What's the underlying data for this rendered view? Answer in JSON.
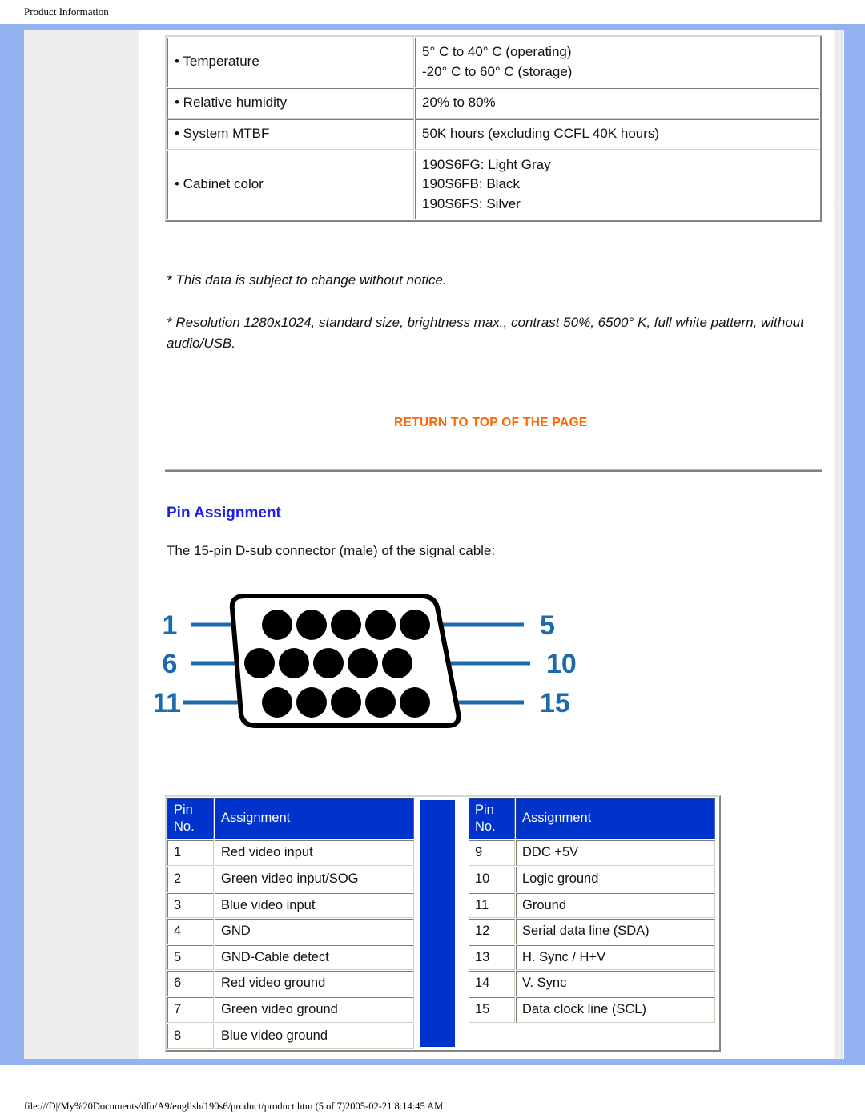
{
  "page": {
    "header_title": "Product Information",
    "footer": "file:///D|/My%20Documents/dfu/A9/english/190s6/product/product.htm (5 of 7)2005-02-21 8:14:45 AM"
  },
  "colors": {
    "frame_blue": "#93b2f2",
    "table_header_blue": "#0033cc",
    "heading_blue": "#1e1ee6",
    "link_orange": "#ff6600",
    "diagram_blue": "#1b6aae",
    "nav_gray": "#eeeeee"
  },
  "spec_table": {
    "rows": [
      {
        "label": "• Temperature",
        "value_lines": [
          "5° C to 40° C (operating)",
          "-20° C to 60° C (storage)"
        ]
      },
      {
        "label": "• Relative humidity",
        "value_lines": [
          "20% to 80%"
        ]
      },
      {
        "label": "• System MTBF",
        "value_lines": [
          "50K hours (excluding CCFL 40K hours)"
        ]
      },
      {
        "label": "• Cabinet color",
        "value_lines": [
          "190S6FG: Light Gray",
          "190S6FB: Black",
          "190S6FS: Silver"
        ]
      }
    ]
  },
  "notes": {
    "note_1": "* This data is subject to change without notice.",
    "note_2": "* Resolution 1280x1024, standard size, brightness max., contrast 50%, 6500° K, full white pattern, without audio/USB."
  },
  "return_link": "RETURN TO TOP OF THE PAGE",
  "pin_assignment": {
    "title": "Pin Assignment",
    "intro": "The 15-pin D-sub connector (male) of the signal cable:",
    "diagram": {
      "left_labels": [
        "1",
        "6",
        "11"
      ],
      "right_labels": [
        "5",
        "10",
        "15"
      ]
    },
    "headers": {
      "pin_no_line1": "Pin",
      "pin_no_line2": "No.",
      "assignment": "Assignment"
    },
    "left_table": [
      {
        "pin": "1",
        "assignment": "Red video input"
      },
      {
        "pin": "2",
        "assignment": "Green video input/SOG"
      },
      {
        "pin": "3",
        "assignment": "Blue video input"
      },
      {
        "pin": "4",
        "assignment": "GND"
      },
      {
        "pin": "5",
        "assignment": "GND-Cable detect"
      },
      {
        "pin": "6",
        "assignment": "Red video ground"
      },
      {
        "pin": "7",
        "assignment": "Green video ground"
      },
      {
        "pin": "8",
        "assignment": "Blue video ground"
      }
    ],
    "right_table": [
      {
        "pin": "9",
        "assignment": "DDC +5V"
      },
      {
        "pin": "10",
        "assignment": "Logic ground"
      },
      {
        "pin": "11",
        "assignment": "Ground"
      },
      {
        "pin": "12",
        "assignment": "Serial data line (SDA)"
      },
      {
        "pin": "13",
        "assignment": "H. Sync / H+V"
      },
      {
        "pin": "14",
        "assignment": "V. Sync"
      },
      {
        "pin": "15",
        "assignment": "Data clock line (SCL)"
      }
    ]
  }
}
